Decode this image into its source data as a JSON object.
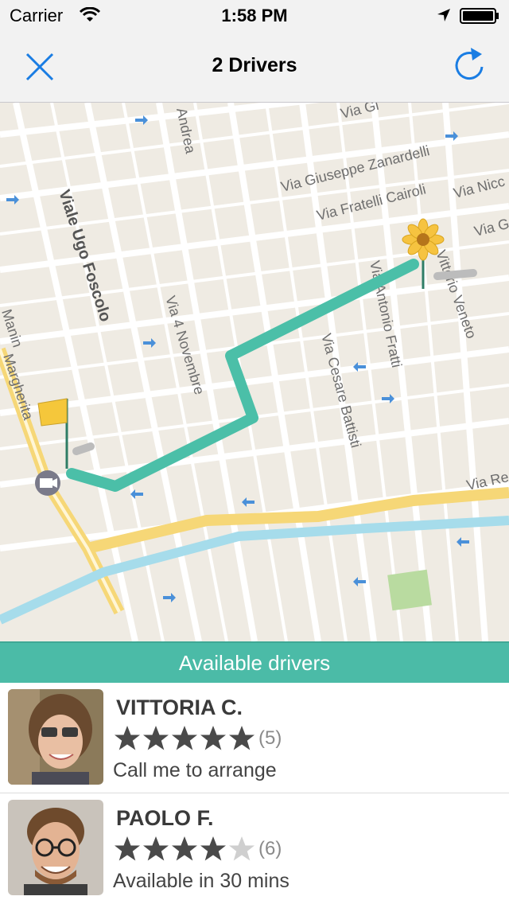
{
  "status_bar": {
    "carrier": "Carrier",
    "time": "1:58 PM"
  },
  "nav": {
    "title": "2 Drivers",
    "close_icon": "close-x-icon",
    "refresh_icon": "refresh-icon"
  },
  "map": {
    "streets": [
      "Via Giuseppe Zanardelli",
      "Via Fratelli Cairoli",
      "Via Nicc",
      "Via G",
      "Via Gi",
      "Andrea",
      "Viale Ugo Foscolo",
      "Via 4 Novembre",
      "Via Antonio Fratti",
      "Via Cesare Battisti",
      "Vittorio Veneto",
      "Via Re",
      "Manin",
      "Margherita"
    ],
    "route_color": "#4bbfa8",
    "start_marker": "flag-icon",
    "end_marker": "sunflower-icon",
    "poi_icon": "cinema-icon"
  },
  "section": {
    "title": "Available drivers",
    "color": "#4bbba7"
  },
  "drivers": [
    {
      "name": "VITTORIA C.",
      "rating": 5,
      "reviews": "(5)",
      "note": "Call me to arrange"
    },
    {
      "name": "PAOLO F.",
      "rating": 4.5,
      "reviews": "(6)",
      "note": "Available in 30 mins"
    }
  ]
}
